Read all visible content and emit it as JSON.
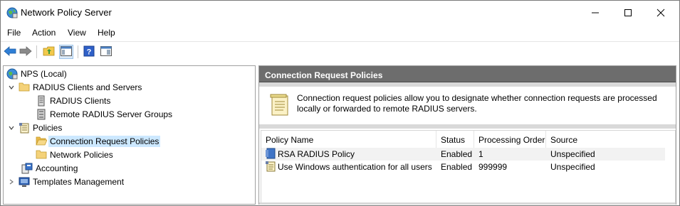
{
  "window": {
    "title": "Network Policy Server"
  },
  "menu": [
    "File",
    "Action",
    "View",
    "Help"
  ],
  "toolbar": {
    "buttons": [
      "back-icon",
      "forward-icon",
      "up-folder-icon",
      "show-hide-console-tree-icon",
      "help-icon",
      "action-pane-icon"
    ]
  },
  "tree": {
    "root": "NPS (Local)",
    "radius_group": "RADIUS Clients and Servers",
    "radius_clients": "RADIUS Clients",
    "remote_groups": "Remote RADIUS Server Groups",
    "policies": "Policies",
    "connection_request_policies": "Connection Request Policies",
    "network_policies": "Network Policies",
    "accounting": "Accounting",
    "templates": "Templates Management"
  },
  "right": {
    "header": "Connection Request Policies",
    "description": "Connection request policies allow you to designate whether connection requests are processed locally or forwarded to remote RADIUS servers.",
    "columns": [
      "Policy Name",
      "Status",
      "Processing Order",
      "Source"
    ],
    "rows": [
      {
        "name": "RSA RADIUS Policy",
        "status": "Enabled",
        "order": "1",
        "source": "Unspecified"
      },
      {
        "name": "Use Windows authentication for all users",
        "status": "Enabled",
        "order": "999999",
        "source": "Unspecified"
      }
    ]
  },
  "colors": {
    "header_bg": "#6d6d6d",
    "selection": "#cce8ff",
    "folder": "#f4c542"
  }
}
